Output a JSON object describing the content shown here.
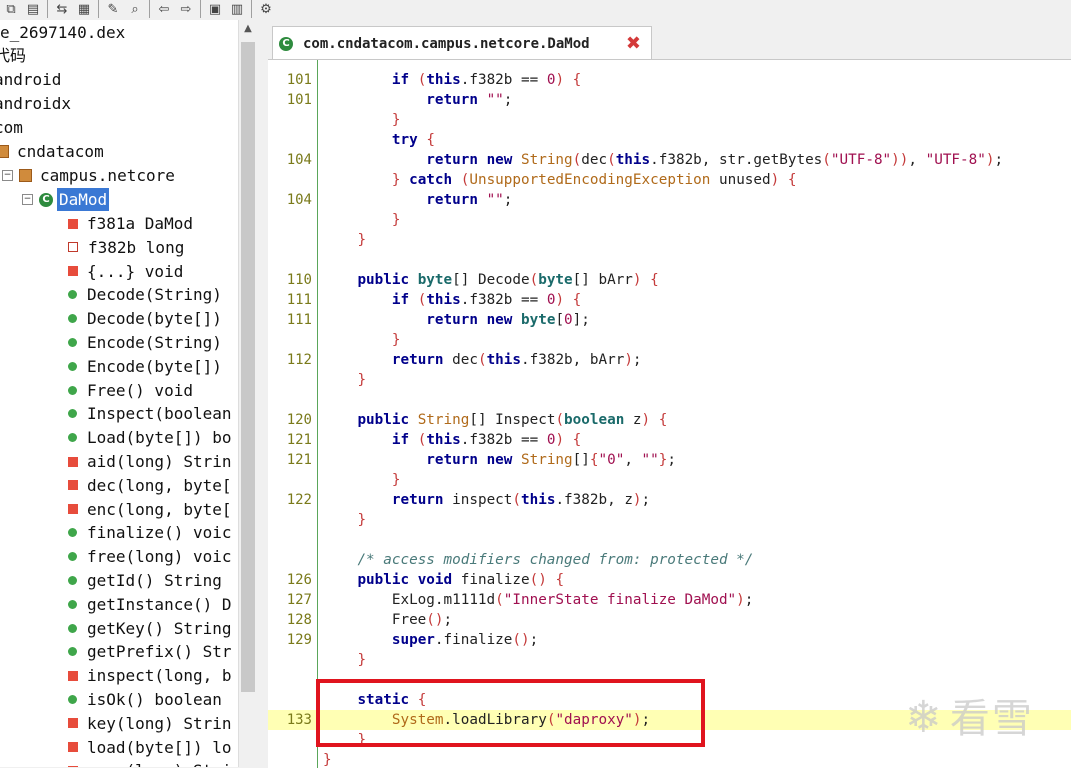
{
  "toolbar": {
    "icons": [
      "copy-icon",
      "save-all-icon",
      "sync-icon",
      "grid-icon",
      "wand-icon",
      "search-icon",
      "back-icon",
      "forward-icon",
      "decompile-icon",
      "log-icon",
      "settings-icon"
    ]
  },
  "tree": {
    "root_file": "e_2697140.dex",
    "source_label": "代码",
    "pkg_android": "android",
    "pkg_androidx": "androidx",
    "pkg_com": "com",
    "pkg_cndatacom": "cndatacom",
    "pkg_campus": "campus.netcore",
    "class_selected": "DaMod",
    "members": [
      {
        "label": "f381a DaMod",
        "icon": "static-field"
      },
      {
        "label": "f382b long",
        "icon": "private-field"
      },
      {
        "label": "{...} void",
        "icon": "static-init"
      },
      {
        "label": "Decode(String)",
        "icon": "public"
      },
      {
        "label": "Decode(byte[])",
        "icon": "public"
      },
      {
        "label": "Encode(String)",
        "icon": "public"
      },
      {
        "label": "Encode(byte[])",
        "icon": "public"
      },
      {
        "label": "Free() void",
        "icon": "public"
      },
      {
        "label": "Inspect(boolean",
        "icon": "public"
      },
      {
        "label": "Load(byte[]) bo",
        "icon": "public"
      },
      {
        "label": "aid(long) Strin",
        "icon": "native"
      },
      {
        "label": "dec(long, byte[",
        "icon": "native"
      },
      {
        "label": "enc(long, byte[",
        "icon": "native"
      },
      {
        "label": "finalize() voic",
        "icon": "public"
      },
      {
        "label": "free(long) voic",
        "icon": "public"
      },
      {
        "label": "getId() String",
        "icon": "public"
      },
      {
        "label": "getInstance() D",
        "icon": "static"
      },
      {
        "label": "getKey() String",
        "icon": "public"
      },
      {
        "label": "getPrefix() Str",
        "icon": "public"
      },
      {
        "label": "inspect(long, b",
        "icon": "native"
      },
      {
        "label": "isOk() boolean",
        "icon": "public"
      },
      {
        "label": "key(long) Strin",
        "icon": "native"
      },
      {
        "label": "load(byte[]) lo",
        "icon": "native"
      },
      {
        "label": "prox(long) Strin",
        "icon": "native"
      }
    ]
  },
  "tab": {
    "title": "com.cndatacom.campus.netcore.DaMod",
    "close": "✖"
  },
  "code_lines": [
    {
      "ln": "101",
      "html": "        <span class='kw'>if</span> <span class='pa'>(</span><span class='kw'>this</span>.f382b == <span class='nu'>0</span><span class='pa'>)</span> <span class='pa'>{</span>"
    },
    {
      "ln": "101",
      "html": "            <span class='kw'>return</span> <span class='st'>\"\"</span>;"
    },
    {
      "ln": "",
      "html": "        <span class='pa'>}</span>"
    },
    {
      "ln": "",
      "html": "        <span class='kw'>try</span> <span class='pa'>{</span>"
    },
    {
      "ln": "104",
      "html": "            <span class='kw'>return</span> <span class='kw'>new</span> <span class='cl'>String</span><span class='pa'>(</span>dec<span class='pa'>(</span><span class='kw'>this</span>.f382b, str.getBytes<span class='pa'>(</span><span class='st'>\"UTF-8\"</span><span class='pa'>))</span>, <span class='st'>\"UTF-8\"</span><span class='pa'>)</span>;"
    },
    {
      "ln": "",
      "html": "        <span class='pa'>}</span> <span class='kw'>catch</span> <span class='pa'>(</span><span class='cl'>UnsupportedEncodingException</span> unused<span class='pa'>)</span> <span class='pa'>{</span>"
    },
    {
      "ln": "104",
      "html": "            <span class='kw'>return</span> <span class='st'>\"\"</span>;"
    },
    {
      "ln": "",
      "html": "        <span class='pa'>}</span>"
    },
    {
      "ln": "",
      "html": "    <span class='pa'>}</span>"
    },
    {
      "ln": "",
      "html": ""
    },
    {
      "ln": "110",
      "html": "    <span class='kw'>public</span> <span class='ty'>byte</span>[] Decode<span class='pa'>(</span><span class='ty'>byte</span>[] bArr<span class='pa'>)</span> <span class='pa'>{</span>"
    },
    {
      "ln": "111",
      "html": "        <span class='kw'>if</span> <span class='pa'>(</span><span class='kw'>this</span>.f382b == <span class='nu'>0</span><span class='pa'>)</span> <span class='pa'>{</span>"
    },
    {
      "ln": "111",
      "html": "            <span class='kw'>return</span> <span class='kw'>new</span> <span class='ty'>byte</span>[<span class='nu'>0</span>];"
    },
    {
      "ln": "",
      "html": "        <span class='pa'>}</span>"
    },
    {
      "ln": "112",
      "html": "        <span class='kw'>return</span> dec<span class='pa'>(</span><span class='kw'>this</span>.f382b, bArr<span class='pa'>)</span>;"
    },
    {
      "ln": "",
      "html": "    <span class='pa'>}</span>"
    },
    {
      "ln": "",
      "html": ""
    },
    {
      "ln": "120",
      "html": "    <span class='kw'>public</span> <span class='cl'>String</span>[] Inspect<span class='pa'>(</span><span class='ty'>boolean</span> z<span class='pa'>)</span> <span class='pa'>{</span>"
    },
    {
      "ln": "121",
      "html": "        <span class='kw'>if</span> <span class='pa'>(</span><span class='kw'>this</span>.f382b == <span class='nu'>0</span><span class='pa'>)</span> <span class='pa'>{</span>"
    },
    {
      "ln": "121",
      "html": "            <span class='kw'>return</span> <span class='kw'>new</span> <span class='cl'>String</span>[]<span class='pa'>{</span><span class='st'>\"0\"</span>, <span class='st'>\"\"</span><span class='pa'>}</span>;"
    },
    {
      "ln": "",
      "html": "        <span class='pa'>}</span>"
    },
    {
      "ln": "122",
      "html": "        <span class='kw'>return</span> inspect<span class='pa'>(</span><span class='kw'>this</span>.f382b, z<span class='pa'>)</span>;"
    },
    {
      "ln": "",
      "html": "    <span class='pa'>}</span>"
    },
    {
      "ln": "",
      "html": ""
    },
    {
      "ln": "",
      "html": "    <span class='cm'>/* access modifiers changed from: protected */</span>"
    },
    {
      "ln": "126",
      "html": "    <span class='kw'>public</span> <span class='kw'>void</span> finalize<span class='pa'>()</span> <span class='pa'>{</span>"
    },
    {
      "ln": "127",
      "html": "        ExLog.m1111d<span class='pa'>(</span><span class='st'>\"InnerState finalize DaMod\"</span><span class='pa'>)</span>;"
    },
    {
      "ln": "128",
      "html": "        Free<span class='pa'>()</span>;"
    },
    {
      "ln": "129",
      "html": "        <span class='kw'>super</span>.finalize<span class='pa'>()</span>;"
    },
    {
      "ln": "",
      "html": "    <span class='pa'>}</span>"
    },
    {
      "ln": "",
      "html": ""
    },
    {
      "ln": "",
      "html": "    <span class='kw'>static</span> <span class='pa'>{</span>"
    },
    {
      "ln": "133",
      "html": "        <span class='cl'>System</span>.loadLibrary<span class='pa'>(</span><span class='st'>\"daproxy\"</span><span class='pa'>)</span>;",
      "highlight": true
    },
    {
      "ln": "",
      "html": "    <span class='pa'>}</span>"
    },
    {
      "ln": "",
      "html": "<span class='pa'>}</span>"
    }
  ],
  "watermark": {
    "text": "看雪"
  },
  "colors": {
    "highlight": "#ffffb4",
    "redbox": "#e0141e",
    "selection": "#3a78d4"
  }
}
